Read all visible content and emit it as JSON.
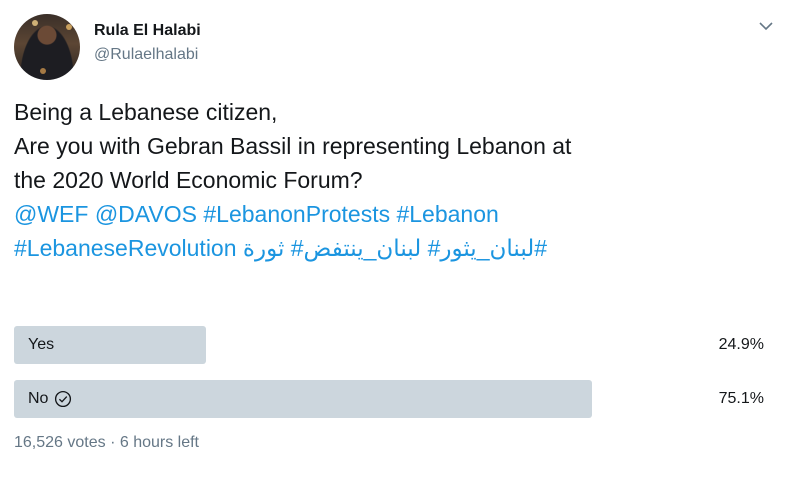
{
  "author": {
    "name": "Rula El Halabi",
    "handle": "@Rulaelhalabi"
  },
  "tweet": {
    "line1": "Being a Lebanese citizen,",
    "line2": "Are you with Gebran Bassil in representing Lebanon at",
    "line3": "the 2020 World Economic Forum?",
    "tags_line1": "@WEF @DAVOS #LebanonProtests  #Lebanon",
    "tags_line2": "#LebaneseRevolution لبنان_يثور# لبنان_ينتفض# ثورة#"
  },
  "poll": {
    "options": [
      {
        "label": "Yes",
        "percent": "24.9%",
        "fraction": 0.249,
        "selected": false
      },
      {
        "label": "No",
        "percent": "75.1%",
        "fraction": 0.751,
        "selected": true
      }
    ],
    "votes": "16,526 votes",
    "time_left": "6 hours left",
    "separator": " · "
  },
  "icons": {
    "more": "chevron-down-icon",
    "selected": "check-circle-icon"
  },
  "colors": {
    "link": "#1b95e0",
    "bar": "#ccd6dd",
    "secondary_text": "#657786"
  }
}
